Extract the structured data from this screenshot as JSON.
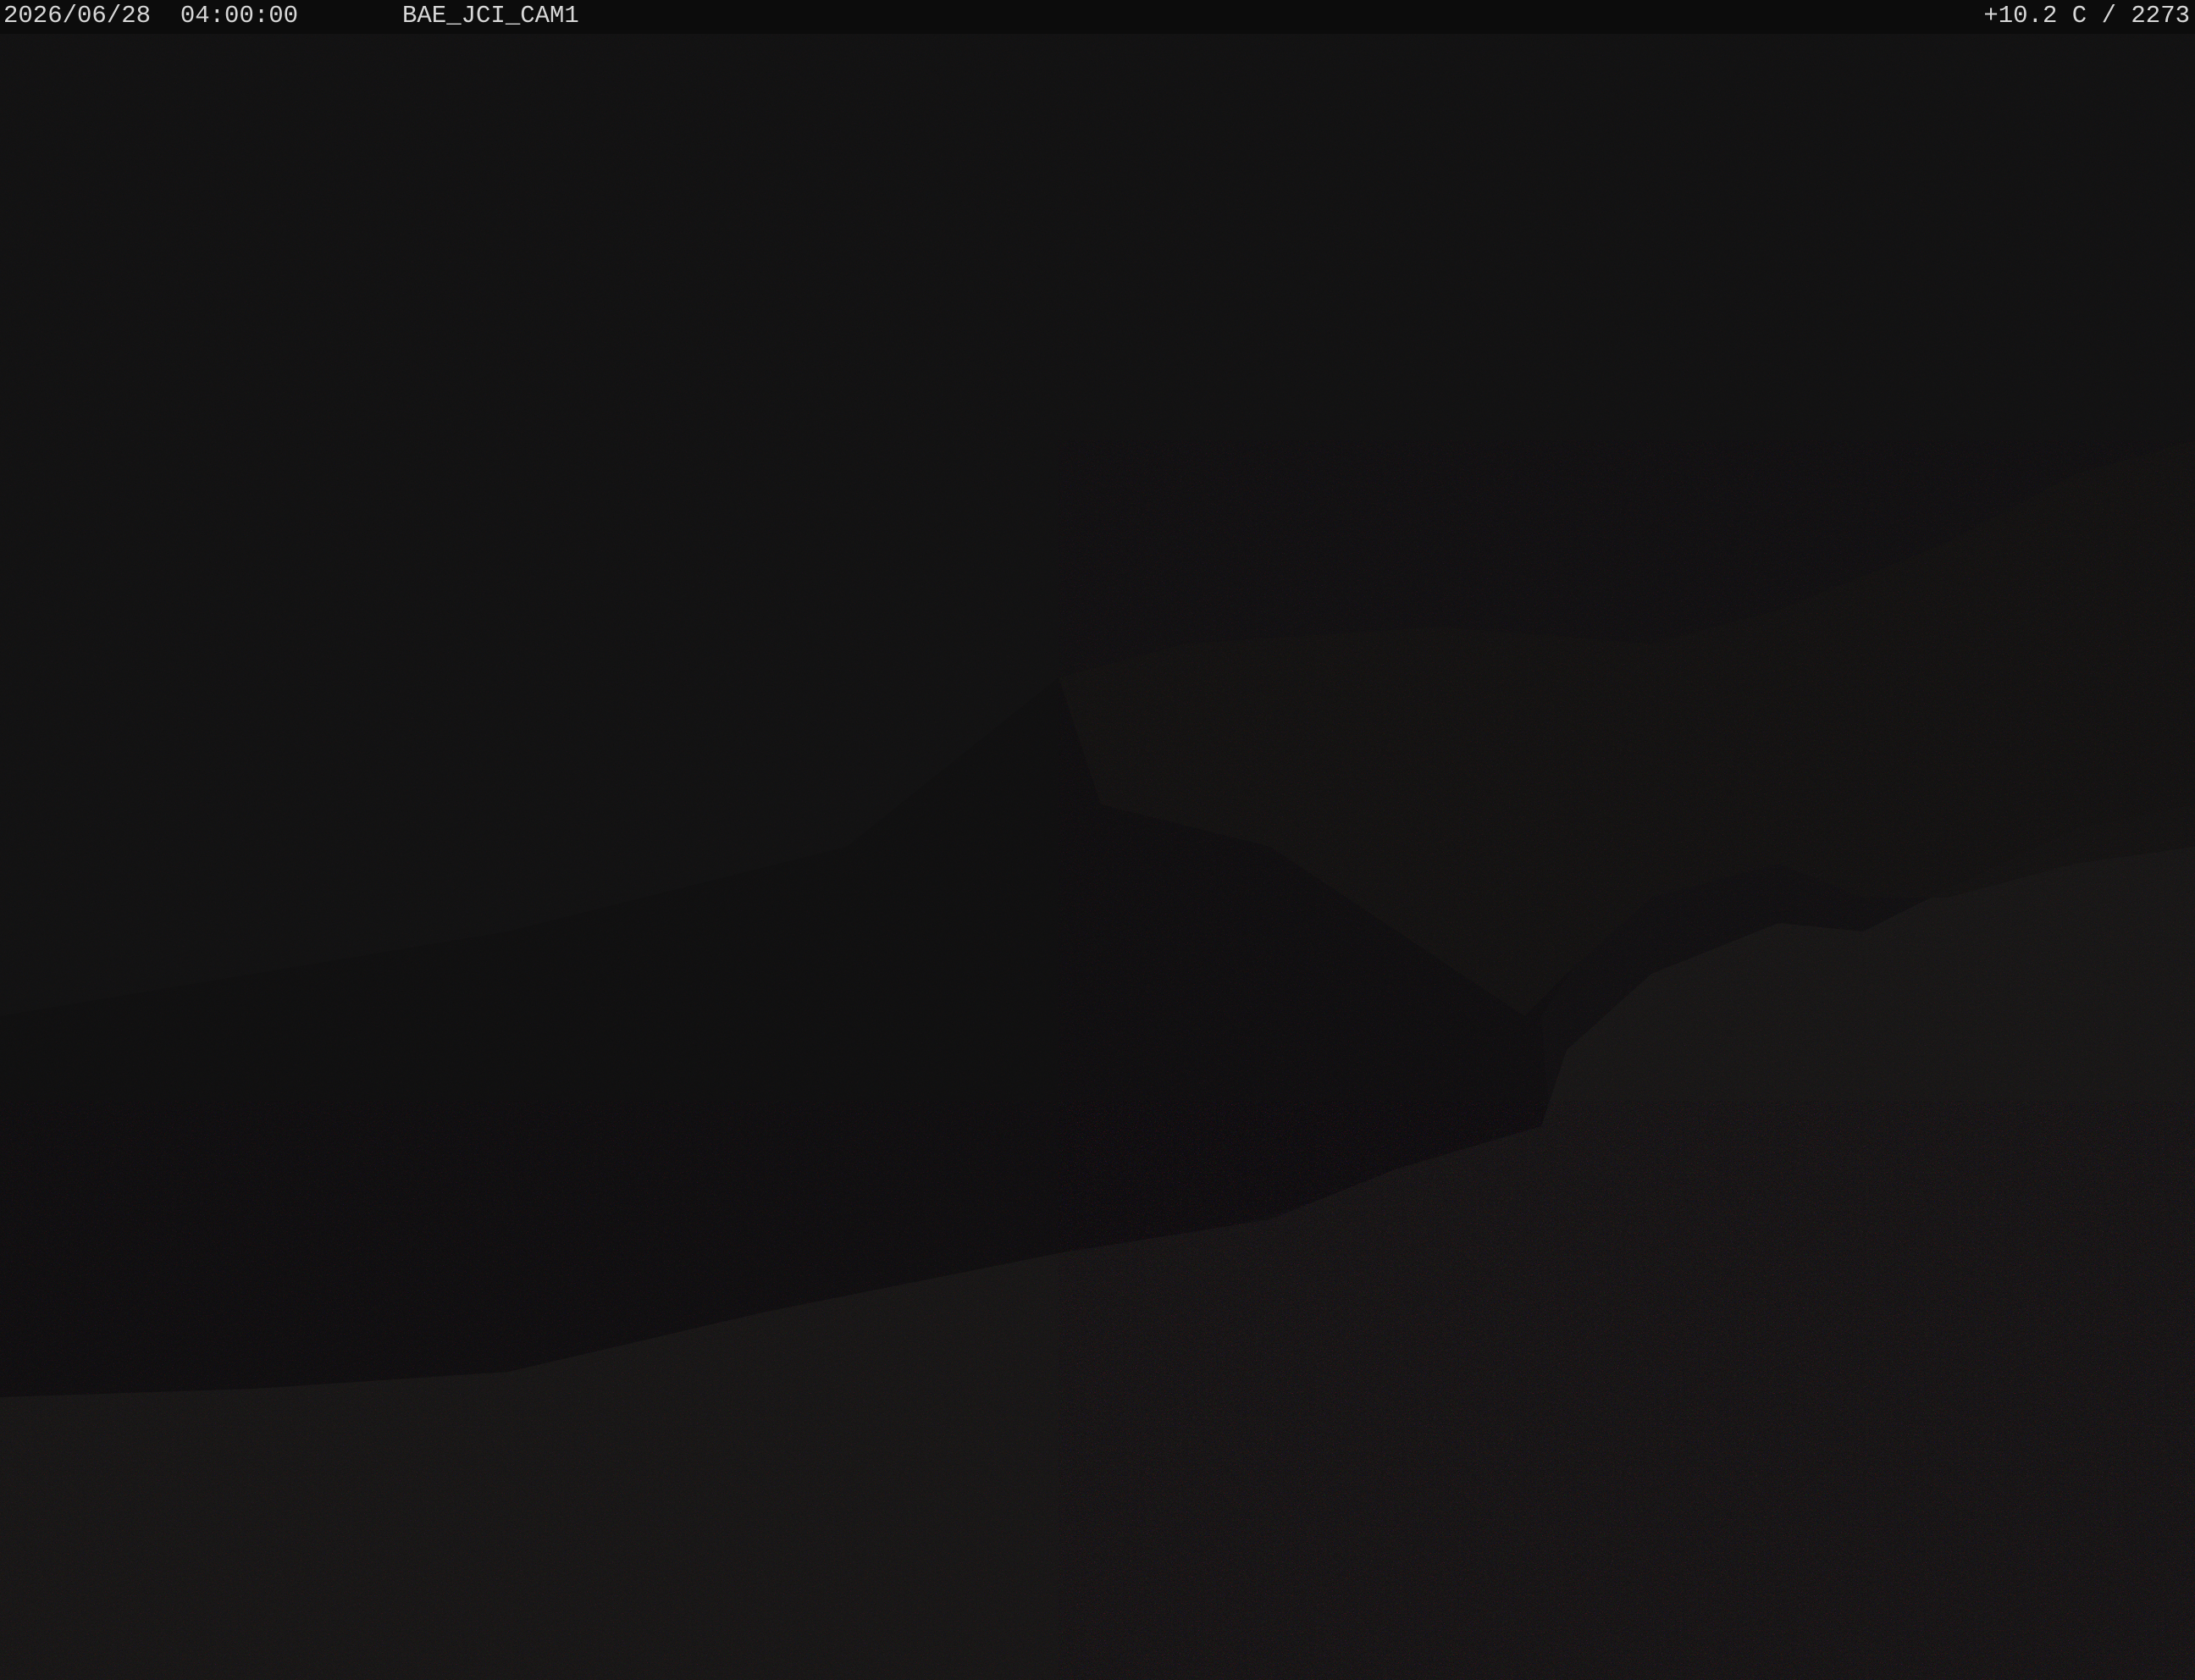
{
  "overlay": {
    "datetime": "2026/06/28  04:00:00",
    "camera_id": "BAE_JCI_CAM1",
    "temperature_reading": "+10.2 C / 2273"
  },
  "scene": {
    "time_of_day": "night",
    "sky_color": "#131313",
    "terrain_color": "#1a1a18",
    "forest_color": "#101010",
    "noise_colors": [
      "#b53a3a",
      "#3b8a3b",
      "#3a3ab5",
      "#7f7f50"
    ]
  }
}
